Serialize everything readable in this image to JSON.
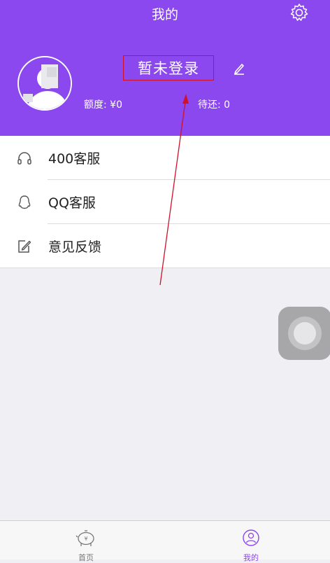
{
  "header": {
    "title": "我的",
    "login_label": "暂未登录",
    "credit_label": "额度: ¥0",
    "repay_label": "待还: 0"
  },
  "menu": {
    "items": [
      {
        "label": "400客服",
        "icon": "headphones-icon"
      },
      {
        "label": "QQ客服",
        "icon": "qq-icon"
      },
      {
        "label": "意见反馈",
        "icon": "edit-icon"
      }
    ]
  },
  "tabbar": {
    "tabs": [
      {
        "label": "首页",
        "icon": "piggy-bank-icon",
        "active": false
      },
      {
        "label": "我的",
        "icon": "profile-icon",
        "active": true
      }
    ]
  },
  "colors": {
    "header_bg": "#8b48ee",
    "active_tab": "#8b48ee",
    "annotation": "#d0112b"
  }
}
